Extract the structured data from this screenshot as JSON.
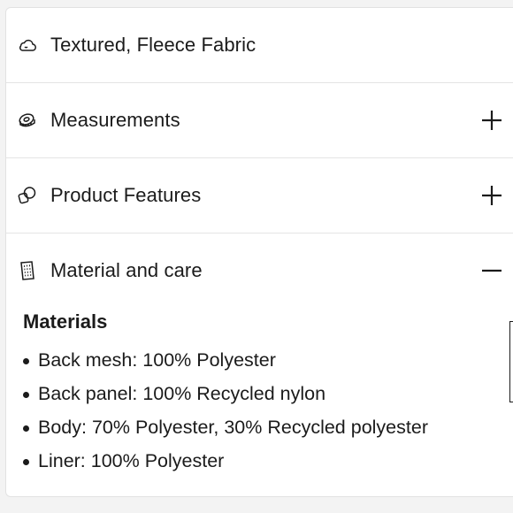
{
  "accordion": {
    "items": [
      {
        "label": "Textured, Fleece Fabric",
        "icon": "cloud-icon",
        "toggle": null
      },
      {
        "label": "Measurements",
        "icon": "measuring-tape-icon",
        "toggle": "+"
      },
      {
        "label": "Product Features",
        "icon": "overlapping-shapes-icon",
        "toggle": "+"
      },
      {
        "label": "Material and care",
        "icon": "fabric-swatch-icon",
        "toggle": "−"
      }
    ],
    "material_section": {
      "heading": "Materials",
      "bullets": [
        "Back mesh: 100% Polyester",
        "Back panel: 100% Recycled nylon",
        "Body: 70% Polyester, 30% Recycled polyester",
        "Liner: 100% Polyester"
      ]
    }
  }
}
